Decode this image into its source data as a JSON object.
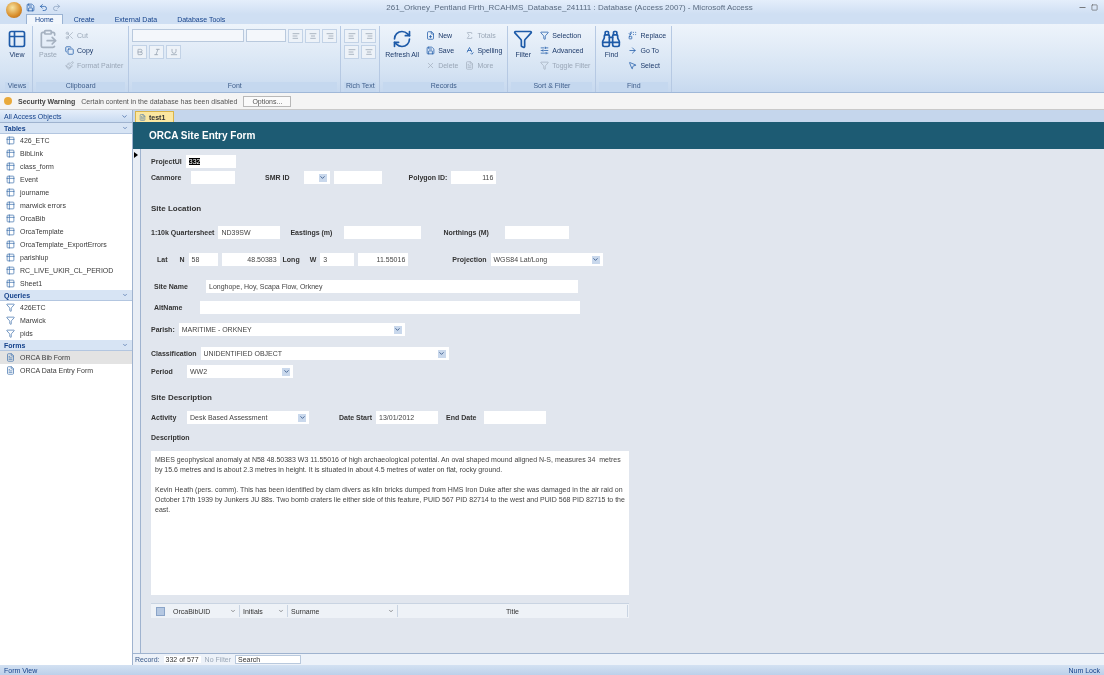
{
  "window": {
    "title": "261_Orkney_Pentland Firth_RCAHMS_Database_241111 : Database (Access 2007) - Microsoft Access"
  },
  "ribbon_tabs": [
    {
      "label": "Home",
      "selected": true
    },
    {
      "label": "Create",
      "selected": false
    },
    {
      "label": "External Data",
      "selected": false
    },
    {
      "label": "Database Tools",
      "selected": false
    }
  ],
  "ribbon_groups": [
    {
      "label": "Views",
      "items": [
        {
          "label": "View",
          "kind": "large",
          "disabled": false
        }
      ]
    },
    {
      "label": "Clipboard",
      "items": [
        {
          "label": "Paste",
          "kind": "large",
          "disabled": true
        },
        {
          "label": "Cut",
          "kind": "small",
          "disabled": true
        },
        {
          "label": "Copy",
          "kind": "small",
          "disabled": false
        },
        {
          "label": "Format Painter",
          "kind": "small",
          "disabled": true
        }
      ]
    },
    {
      "label": "Font"
    },
    {
      "label": "Rich Text"
    },
    {
      "label": "Records",
      "items": [
        {
          "label": "Refresh All",
          "kind": "large",
          "disabled": false
        },
        {
          "label": "New",
          "kind": "small",
          "disabled": false
        },
        {
          "label": "Save",
          "kind": "small",
          "disabled": false
        },
        {
          "label": "Delete",
          "kind": "small",
          "disabled": true
        },
        {
          "label": "Totals",
          "kind": "small",
          "disabled": true
        },
        {
          "label": "Spelling",
          "kind": "small",
          "disabled": false
        },
        {
          "label": "More",
          "kind": "small",
          "disabled": true
        }
      ]
    },
    {
      "label": "Sort & Filter",
      "items": [
        {
          "label": "Filter",
          "kind": "large",
          "disabled": false
        },
        {
          "label": "Selection",
          "kind": "small",
          "disabled": false
        },
        {
          "label": "Advanced",
          "kind": "small",
          "disabled": false
        },
        {
          "label": "Toggle Filter",
          "kind": "small",
          "disabled": true
        }
      ]
    },
    {
      "label": "Find",
      "items": [
        {
          "label": "Find",
          "kind": "large",
          "disabled": false
        },
        {
          "label": "Replace",
          "kind": "small",
          "disabled": false
        },
        {
          "label": "Go To",
          "kind": "small",
          "disabled": false
        },
        {
          "label": "Select",
          "kind": "small",
          "disabled": false
        }
      ]
    }
  ],
  "security_bar": {
    "title": "Security Warning",
    "message": "Certain content in the database has been disabled",
    "button": "Options..."
  },
  "nav_pane": {
    "title": "All Access Objects",
    "groups": [
      {
        "label": "Tables",
        "kind": "table",
        "items": [
          {
            "label": "426_ETC",
            "selected": false
          },
          {
            "label": "BibLink",
            "selected": false
          },
          {
            "label": "class_form",
            "selected": false
          },
          {
            "label": "Event",
            "selected": false
          },
          {
            "label": "journame",
            "selected": false
          },
          {
            "label": "marwick errors",
            "selected": false
          },
          {
            "label": "OrcaBib",
            "selected": false
          },
          {
            "label": "OrcaTemplate",
            "selected": false
          },
          {
            "label": "OrcaTemplate_ExportErrors",
            "selected": false
          },
          {
            "label": "parishlup",
            "selected": false
          },
          {
            "label": "RC_LIVE_UKIR_CL_PERIOD",
            "selected": false
          },
          {
            "label": "Sheet1",
            "selected": false
          }
        ]
      },
      {
        "label": "Queries",
        "kind": "query",
        "items": [
          {
            "label": "426ETC",
            "selected": false
          },
          {
            "label": "Marwick",
            "selected": false
          },
          {
            "label": "pids",
            "selected": false
          }
        ]
      },
      {
        "label": "Forms",
        "kind": "form",
        "items": [
          {
            "label": "ORCA Bib Form",
            "selected": true
          },
          {
            "label": "ORCA Data Entry Form",
            "selected": false
          }
        ]
      }
    ]
  },
  "document_tab": {
    "label": "test1"
  },
  "form": {
    "title": "ORCA Site Entry Form",
    "project_ui": {
      "label": "ProjectUI",
      "value": "332",
      "text_selected": true
    },
    "canmore": {
      "label": "Canmore"
    },
    "smr_id": {
      "label": "SMR ID"
    },
    "polygon_id": {
      "label": "Polygon ID:",
      "value": "116"
    },
    "site_location": "Site Location",
    "quartersheet": {
      "label": "1:10k Quartersheet",
      "value": "ND39SW"
    },
    "eastings": {
      "label": "Eastings (m)"
    },
    "northings": {
      "label": "Northings (M)"
    },
    "lat": {
      "label": "Lat",
      "hemisphere": "N",
      "degrees": "58",
      "minutes": "48.50383"
    },
    "long": {
      "label": "Long",
      "hemisphere": "W",
      "degrees": "3",
      "minutes": "11.55016"
    },
    "projection": {
      "label": "Projection",
      "value": "WGS84 Lat/Long"
    },
    "site_name": {
      "label": "Site Name",
      "value": "Longhope, Hoy, Scapa Flow, Orkney"
    },
    "alt_name": {
      "label": "AltName"
    },
    "parish": {
      "label": "Parish:",
      "value": "MARITIME - ORKNEY"
    },
    "classification": {
      "label": "Classification",
      "value": "UNIDENTIFIED OBJECT"
    },
    "period": {
      "label": "Period",
      "value": "WW2"
    },
    "site_description": "Site Description",
    "activity": {
      "label": "Activity",
      "value": "Desk Based Assessment"
    },
    "date_start": {
      "label": "Date Start",
      "value": "13/01/2012"
    },
    "end_date": {
      "label": "End Date"
    },
    "description": {
      "label": "Description",
      "value": "MBES geophysical anomaly at N58 48.50383 W3 11.55016 of high archaeological potential. An oval shaped mound aligned N-S, measures 34  metres by 15.6 metres and is about 2.3 metres in height. It is situated in about 4.5 metres of water on flat, rocky ground.\n\nKevin Heath (pers. comm). This has been identified by clam divers as kiln bricks dumped from HMS Iron Duke after she was damaged in the air raid on October 17th 1939 by Junkers JU 88s. Two bomb craters lie either side of this feature, PUID 567 PID 82714 to the west and PUID 568 PID 82715 to the east."
    },
    "subform_columns": [
      "OrcaBibUID",
      "Initials",
      "Surname",
      "Title"
    ]
  },
  "record_nav": {
    "label": "Record:",
    "position": "332 of 577",
    "filter": "No Filter",
    "search": "Search"
  },
  "status_bar": {
    "left": "Form View",
    "right": "Num Lock"
  }
}
